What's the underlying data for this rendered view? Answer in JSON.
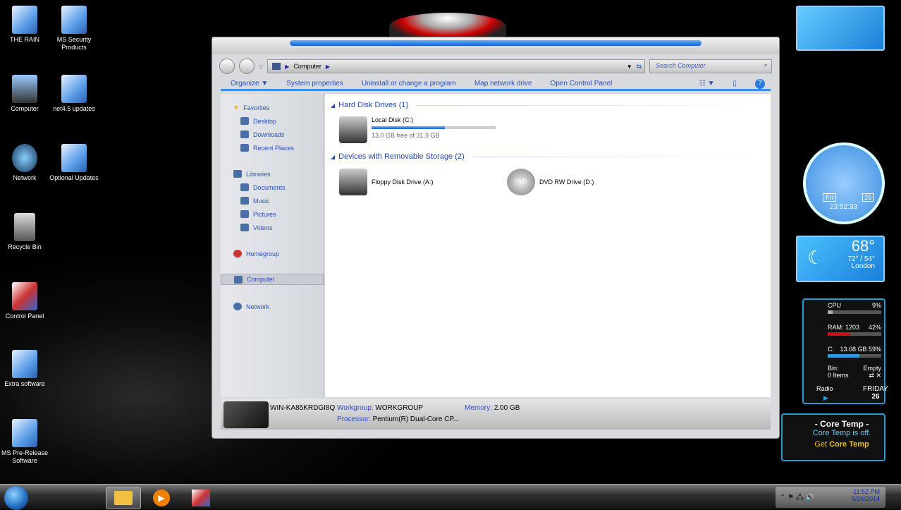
{
  "desktop": {
    "icons": [
      {
        "label": "THE RAIN",
        "icon": "rain-icon"
      },
      {
        "label": "MS Security Products",
        "icon": "folder-icon"
      },
      {
        "label": "Computer",
        "icon": "computer-icon"
      },
      {
        "label": "net4.5 updates",
        "icon": "folder-icon"
      },
      {
        "label": "Network",
        "icon": "network-icon"
      },
      {
        "label": "Optional Updates",
        "icon": "folder-icon"
      },
      {
        "label": "Recycle Bin",
        "icon": "recycle-bin-icon"
      },
      {
        "label": "Control Panel",
        "icon": "control-panel-icon"
      },
      {
        "label": "Extra software",
        "icon": "folder-icon"
      },
      {
        "label": "MS Pre-Release Software",
        "icon": "folder-icon"
      }
    ]
  },
  "explorer": {
    "address": {
      "crumb": "Computer"
    },
    "search_placeholder": "Search Computer",
    "commands": [
      "Organize",
      "System properties",
      "Uninstall or change a program",
      "Map network drive",
      "Open Control Panel"
    ],
    "nav": {
      "favorites": "Favorites",
      "fav_items": [
        "Desktop",
        "Downloads",
        "Recent Places"
      ],
      "libraries": "Libraries",
      "lib_items": [
        "Documents",
        "Music",
        "Pictures",
        "Videos"
      ],
      "homegroup": "Homegroup",
      "computer": "Computer",
      "network": "Network"
    },
    "groups": [
      {
        "title": "Hard Disk Drives (1)",
        "drives": [
          {
            "name": "Local Disk (C:)",
            "free": "13.0 GB free of 31.9 GB",
            "used_fraction": 0.59
          }
        ]
      },
      {
        "title": "Devices with Removable Storage (2)",
        "drives": [
          {
            "name": "Floppy Disk Drive (A:)"
          },
          {
            "name": "DVD RW Drive (D:)",
            "badge": "DVD"
          }
        ]
      }
    ],
    "details": {
      "name": "WIN-KA85KRDGI8Q",
      "workgroup_label": "Workgroup:",
      "workgroup": "WORKGROUP",
      "memory_label": "Memory:",
      "memory": "2.00 GB",
      "processor_label": "Processor:",
      "processor": "Pentium(R) Dual-Core  CP..."
    }
  },
  "gadgets": {
    "clock": {
      "day": "Fri",
      "date": "26",
      "time": "23:52:33"
    },
    "weather": {
      "temp": "68°",
      "range": "72° / 54°",
      "city": "London"
    },
    "meter": {
      "cpu_label": "CPU",
      "cpu": "9%",
      "cpu_value": 0.09,
      "ram_label": "RAM: 1203",
      "ram": "42%",
      "ram_value": 0.42,
      "disk_label": "C:",
      "disk": "13.08 GB 59%",
      "disk_value": 0.59,
      "bin_label": "Bin:",
      "bin_status": "Empty",
      "bin_items": "0 Items",
      "radio": "Radio",
      "weekday": "FRIDAY",
      "day": "26"
    },
    "coretemp": {
      "title": "- Core Temp -",
      "status": "Core Temp is off.",
      "get": "Get",
      "link": "Core Temp"
    }
  },
  "taskbar": {
    "time": "11:52 PM",
    "date": "9/26/2014"
  },
  "colors": {
    "accent": "#2a4fc0",
    "bar": "#1660d0",
    "ram": "#d01010"
  }
}
